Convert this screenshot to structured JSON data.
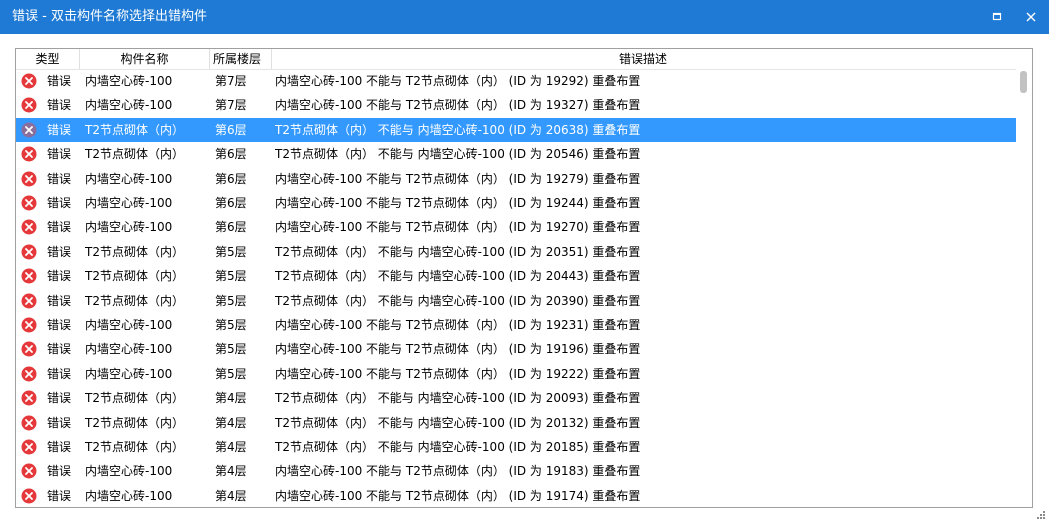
{
  "window": {
    "title": "错误 - 双击构件名称选择出错构件",
    "titlebar_color": "#1e7ad4",
    "controls": [
      "maximize-icon",
      "close-icon"
    ]
  },
  "columns": [
    "类型",
    "构件名称",
    "所属楼层",
    "错误描述"
  ],
  "selection_color": "#3399ff",
  "error_icon": "error-x-circle-icon",
  "error_icon_color": "#e5383b",
  "rows": [
    {
      "type": "错误",
      "name": "内墙空心砖-100",
      "floor": "第7层",
      "desc": "内墙空心砖-100 不能与 T2节点砌体（内） (ID 为 19292) 重叠布置"
    },
    {
      "type": "错误",
      "name": "内墙空心砖-100",
      "floor": "第7层",
      "desc": "内墙空心砖-100 不能与 T2节点砌体（内） (ID 为 19327) 重叠布置"
    },
    {
      "type": "错误",
      "name": "T2节点砌体（内）",
      "floor": "第6层",
      "desc": "T2节点砌体（内） 不能与 内墙空心砖-100 (ID 为 20638) 重叠布置",
      "selected": true
    },
    {
      "type": "错误",
      "name": "T2节点砌体（内）",
      "floor": "第6层",
      "desc": "T2节点砌体（内） 不能与 内墙空心砖-100 (ID 为 20546) 重叠布置"
    },
    {
      "type": "错误",
      "name": "内墙空心砖-100",
      "floor": "第6层",
      "desc": "内墙空心砖-100 不能与 T2节点砌体（内） (ID 为 19279) 重叠布置"
    },
    {
      "type": "错误",
      "name": "内墙空心砖-100",
      "floor": "第6层",
      "desc": "内墙空心砖-100 不能与 T2节点砌体（内） (ID 为 19244) 重叠布置"
    },
    {
      "type": "错误",
      "name": "内墙空心砖-100",
      "floor": "第6层",
      "desc": "内墙空心砖-100 不能与 T2节点砌体（内） (ID 为 19270) 重叠布置"
    },
    {
      "type": "错误",
      "name": "T2节点砌体（内）",
      "floor": "第5层",
      "desc": "T2节点砌体（内） 不能与 内墙空心砖-100 (ID 为 20351) 重叠布置"
    },
    {
      "type": "错误",
      "name": "T2节点砌体（内）",
      "floor": "第5层",
      "desc": "T2节点砌体（内） 不能与 内墙空心砖-100 (ID 为 20443) 重叠布置"
    },
    {
      "type": "错误",
      "name": "T2节点砌体（内）",
      "floor": "第5层",
      "desc": "T2节点砌体（内） 不能与 内墙空心砖-100 (ID 为 20390) 重叠布置"
    },
    {
      "type": "错误",
      "name": "内墙空心砖-100",
      "floor": "第5层",
      "desc": "内墙空心砖-100 不能与 T2节点砌体（内） (ID 为 19231) 重叠布置"
    },
    {
      "type": "错误",
      "name": "内墙空心砖-100",
      "floor": "第5层",
      "desc": "内墙空心砖-100 不能与 T2节点砌体（内） (ID 为 19196) 重叠布置"
    },
    {
      "type": "错误",
      "name": "内墙空心砖-100",
      "floor": "第5层",
      "desc": "内墙空心砖-100 不能与 T2节点砌体（内） (ID 为 19222) 重叠布置"
    },
    {
      "type": "错误",
      "name": "T2节点砌体（内）",
      "floor": "第4层",
      "desc": "T2节点砌体（内） 不能与 内墙空心砖-100 (ID 为 20093) 重叠布置"
    },
    {
      "type": "错误",
      "name": "T2节点砌体（内）",
      "floor": "第4层",
      "desc": "T2节点砌体（内） 不能与 内墙空心砖-100 (ID 为 20132) 重叠布置"
    },
    {
      "type": "错误",
      "name": "T2节点砌体（内）",
      "floor": "第4层",
      "desc": "T2节点砌体（内） 不能与 内墙空心砖-100 (ID 为 20185) 重叠布置"
    },
    {
      "type": "错误",
      "name": "内墙空心砖-100",
      "floor": "第4层",
      "desc": "内墙空心砖-100 不能与 T2节点砌体（内） (ID 为 19183) 重叠布置"
    },
    {
      "type": "错误",
      "name": "内墙空心砖-100",
      "floor": "第4层",
      "desc": "内墙空心砖-100 不能与 T2节点砌体（内） (ID 为 19174) 重叠布置"
    }
  ]
}
